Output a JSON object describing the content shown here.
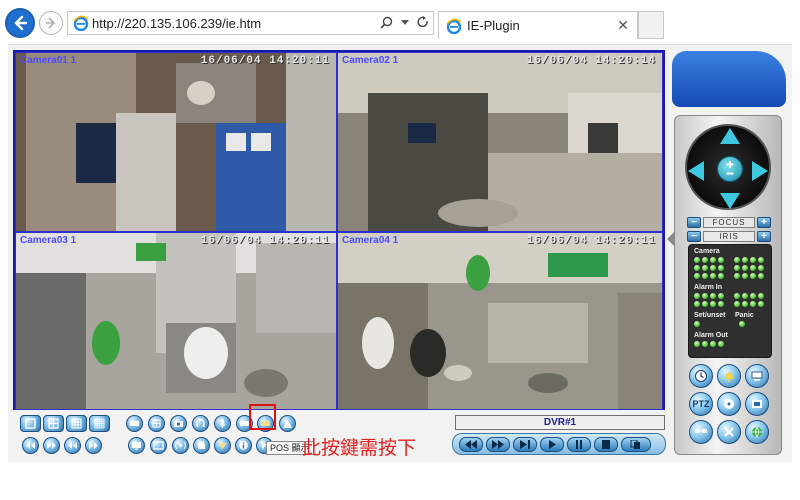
{
  "browser": {
    "url": "http://220.135.106.239/ie.htm",
    "tab_title": "IE-Plugin",
    "tab_close": "✕",
    "nav_icons": [
      "back-arrow-icon",
      "forward-arrow-icon"
    ],
    "addr_icons": [
      "search-icon",
      "dropdown-caret-icon",
      "refresh-icon"
    ]
  },
  "cameras": [
    {
      "name": "Camera01 1",
      "time": "16/06/04 14:20:11"
    },
    {
      "name": "Camera02 1",
      "time": "16/06/04 14:20:14"
    },
    {
      "name": "Camera03 1",
      "time": "16/06/04 14:20:11"
    },
    {
      "name": "Camera04 1",
      "time": "16/06/04 14:20:11"
    }
  ],
  "toolbar": {
    "pos_tooltip": "POS 顯示",
    "notice": "此按鍵需按下"
  },
  "dvr": {
    "label": "DVR#1"
  },
  "ptz": {
    "focus_label": "FOCUS",
    "iris_label": "IRIS",
    "minus": "−",
    "plus": "+"
  },
  "status": {
    "camera_label": "Camera",
    "alarm_in_label": "Alarm In",
    "setunset_label": "Set/unset",
    "panic_label": "Panic",
    "alarm_out_label": "Alarm Out"
  },
  "side_buttons": {
    "ptz_label": "PTZ"
  },
  "colors": {
    "accent_blue": "#1e6fd0",
    "grid_border": "#1a1aa8",
    "notice_red": "#e02020",
    "led_green": "#56c83a"
  }
}
